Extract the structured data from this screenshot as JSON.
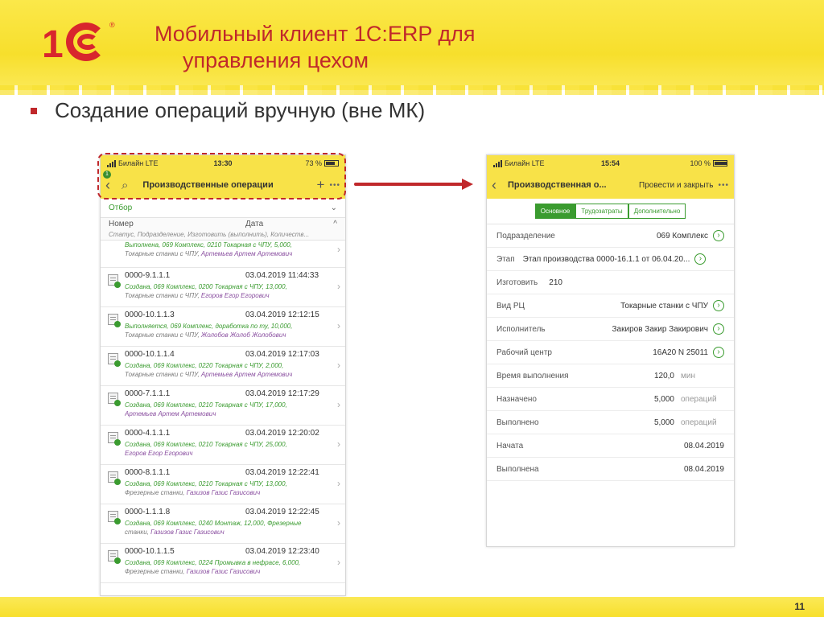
{
  "slide": {
    "title_line1": "Мобильный клиент 1С:ERP для",
    "title_line2": "управления цехом",
    "bullet": "Создание операций вручную (вне МК)",
    "page_number": "11",
    "logo_text": "1С",
    "accent_color": "#c0282b",
    "banner_color": "#f7df2c"
  },
  "phone1": {
    "status": {
      "carrier": "Билайн",
      "network": "LTE",
      "time": "13:30",
      "battery": "73 %"
    },
    "nav": {
      "badge": "1",
      "back": "‹",
      "search_icon": "⌕",
      "title": "Производственные операции",
      "add": "+",
      "more": "•••"
    },
    "filter": {
      "label": "Отбор",
      "chevron": "⌄"
    },
    "columns": {
      "number": "Номер",
      "date": "Дата",
      "sort": "^",
      "subheader": "Статус, Подразделение, Изготовить (выполнить), Количеств..."
    },
    "partial_row": {
      "line1": "Выполнена, 069 Комплекс, 0210 Токарная с ЧПУ, 5,000,",
      "line2a": "Токарные станки с ЧПУ, ",
      "line2b": "Артемьев Артем Артемович"
    },
    "rows": [
      {
        "number": "0000-9.1.1.1",
        "date": "03.04.2019 11:44:33",
        "l1": "Создана, 069 Комплекс, 0200 Токарная с ЧПУ, 13,000,",
        "l2a": "Токарные станки с ЧПУ, ",
        "l2b": "Егоров Егор Егорович"
      },
      {
        "number": "0000-10.1.1.3",
        "date": "03.04.2019 12:12:15",
        "l1": "Выполняется, 069 Комплекс, доработка по ту, 10,000,",
        "l2a": "Токарные станки с ЧПУ, ",
        "l2b": "Жолобов Жолоб Жолобович"
      },
      {
        "number": "0000-10.1.1.4",
        "date": "03.04.2019 12:17:03",
        "l1": "Создана, 069 Комплекс, 0220 Токарная с ЧПУ, 2,000,",
        "l2a": "Токарные станки с ЧПУ, ",
        "l2b": "Артемьев Артем Артемович"
      },
      {
        "number": "0000-7.1.1.1",
        "date": "03.04.2019 12:17:29",
        "l1": "Создана, 069 Комплекс, 0210 Токарная с ЧПУ, 17,000,",
        "l2a": "",
        "l2b": "Артемьев Артем Артемович"
      },
      {
        "number": "0000-4.1.1.1",
        "date": "03.04.2019 12:20:02",
        "l1": "Создана, 069 Комплекс, 0210 Токарная с ЧПУ, 25,000,",
        "l2a": "",
        "l2b": "Егоров Егор Егорович"
      },
      {
        "number": "0000-8.1.1.1",
        "date": "03.04.2019 12:22:41",
        "l1": "Создана, 069 Комплекс, 0210 Токарная с ЧПУ, 13,000,",
        "l2a": "Фрезерные станки, ",
        "l2b": "Газизов Газис Газисович"
      },
      {
        "number": "0000-1.1.1.8",
        "date": "03.04.2019 12:22:45",
        "l1": "Создана, 069 Комплекс, 0240 Монтаж, 12,000, Фрезерные",
        "l2a": "станки, ",
        "l2b": "Газизов Газис Газисович"
      },
      {
        "number": "0000-10.1.1.5",
        "date": "03.04.2019 12:23:40",
        "l1": "Создана, 069 Комплекс, 0224 Промывка в нефрасе, 6,000,",
        "l2a": "Фрезерные станки, ",
        "l2b": "Газизов Газис Газисович"
      }
    ]
  },
  "phone2": {
    "status": {
      "carrier": "Билайн",
      "network": "LTE",
      "time": "15:54",
      "battery": "100 %"
    },
    "nav": {
      "back": "‹",
      "title": "Производственная о...",
      "action": "Провести и закрыть",
      "more": "•••"
    },
    "tabs": [
      "Основное",
      "Трудозатраты",
      "Дополнительно"
    ],
    "fields": [
      {
        "label": "Подразделение",
        "value": "069 Комплекс",
        "unit": "",
        "link": true
      },
      {
        "label": "Этап",
        "value": "Этап производства 0000-16.1.1 от 06.04.20...",
        "unit": "",
        "link": true
      },
      {
        "label": "Изготовить",
        "value": "210",
        "unit": "",
        "link": false
      },
      {
        "label": "Вид РЦ",
        "value": "Токарные станки с ЧПУ",
        "unit": "",
        "link": true
      },
      {
        "label": "Исполнитель",
        "value": "Закиров Закир Закирович",
        "unit": "",
        "link": true
      },
      {
        "label": "Рабочий центр",
        "value": "16А20 N 25011",
        "unit": "",
        "link": true
      },
      {
        "label": "Время выполнения",
        "value": "120,0",
        "unit": "мин",
        "link": false
      },
      {
        "label": "Назначено",
        "value": "5,000",
        "unit": "операций",
        "link": false
      },
      {
        "label": "Выполнено",
        "value": "5,000",
        "unit": "операций",
        "link": false
      },
      {
        "label": "Начата",
        "value": "08.04.2019",
        "unit": "",
        "link": false
      },
      {
        "label": "Выполнена",
        "value": "08.04.2019",
        "unit": "",
        "link": false
      }
    ]
  }
}
